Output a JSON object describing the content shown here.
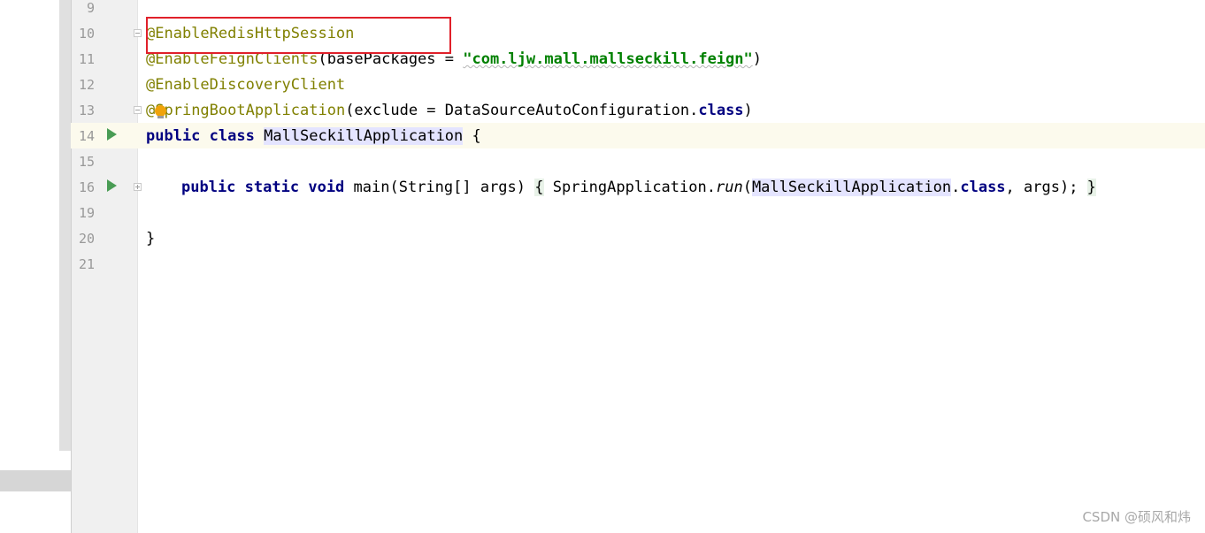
{
  "gutter": {
    "line_numbers": [
      "9",
      "10",
      "11",
      "12",
      "13",
      "14",
      "15",
      "16",
      "19",
      "20",
      "21"
    ]
  },
  "code": {
    "line10": {
      "annotation": "@EnableRedisHttpSession"
    },
    "line11": {
      "annotation": "@EnableFeignClients",
      "open": "(basePackages = ",
      "string": "\"com.ljw.mall.mallseckill.feign\"",
      "close": ")"
    },
    "line12": {
      "annotation": "@EnableDiscoveryClient"
    },
    "line13": {
      "at": "@",
      "annotation": "SpringBootApplication",
      "args": "(exclude = DataSourceAutoConfiguration.",
      "kw_class": "class",
      "close": ")"
    },
    "line14": {
      "kw_public": "public",
      "kw_class": "class",
      "class_name": "MallSeckillApplication",
      "brace": "{"
    },
    "line16": {
      "kw_public": "public",
      "kw_static": "static",
      "kw_void": "void",
      "signature": "main(String[] args) ",
      "open_brace": "{",
      "call_prefix": " SpringApplication.",
      "method": "run",
      "paren": "(",
      "class_ref": "MallSeckillApplication",
      "dot": ".",
      "kw_class": "class",
      "rest": ", args); ",
      "close_brace": "}"
    },
    "line20": {
      "brace": "}"
    }
  },
  "watermark": "CSDN @硕风和炜",
  "colors": {
    "annotation": "#808000",
    "keyword": "#000080",
    "string": "#008000",
    "highlight_box": "#e0202a",
    "run_icon": "#499c54"
  }
}
